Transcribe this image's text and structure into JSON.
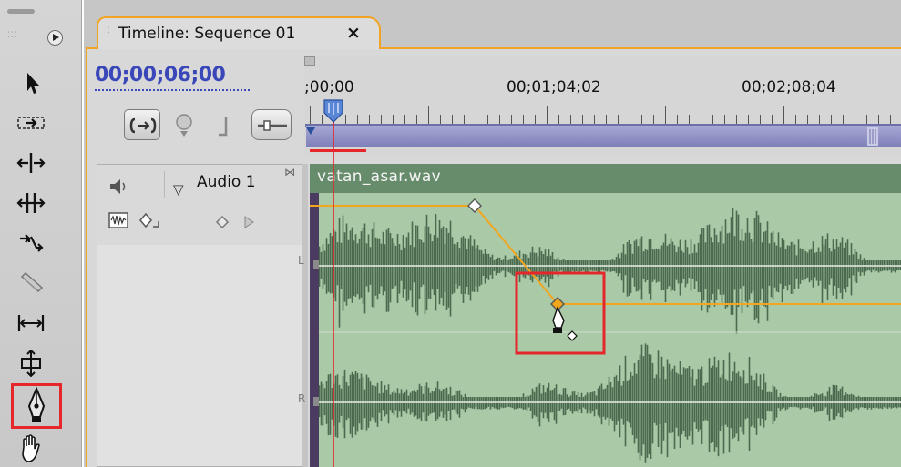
{
  "timeline_panel": {
    "tab_title": "Timeline: Sequence 01",
    "close_glyph": "×",
    "current_timecode": "00;00;06;00"
  },
  "ruler": {
    "labels": [
      ";00;00",
      "00;01;04;02",
      "00;02;08;04"
    ]
  },
  "track": {
    "name": "Audio 1",
    "clip_name": "vatan_asar.wav",
    "channel_left": "L",
    "channel_right": "R",
    "collapse_glyph": "▽"
  },
  "tools": [
    "selection-tool-icon",
    "track-select-tool-icon",
    "ripple-edit-tool-icon",
    "rolling-edit-tool-icon",
    "rate-stretch-tool-icon",
    "razor-tool-icon",
    "slip-tool-icon",
    "slide-tool-icon",
    "pen-tool-icon",
    "hand-tool-icon"
  ],
  "selected_tool": "pen-tool-icon",
  "colors": {
    "panel_accent": "#f1a423",
    "timecode": "#3a47b8",
    "highlight": "#e5262b",
    "clip_bar": "#678c6c",
    "clip_body": "#a9c9a7",
    "waveform": "#4c6a4f",
    "keyframe_line": "#f2a61d",
    "playhead": "#e5262b",
    "work_area": "#8f91c8"
  }
}
